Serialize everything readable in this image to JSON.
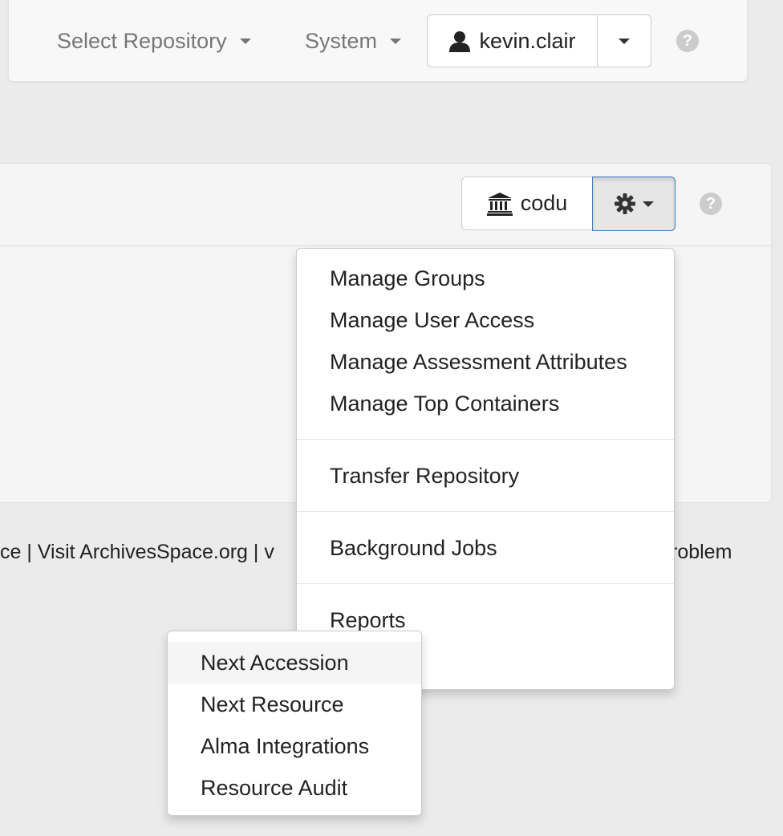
{
  "navbar": {
    "select_repository": "Select Repository",
    "system": "System",
    "username": "kevin.clair",
    "help": "?"
  },
  "repo": {
    "code": "codu",
    "help": "?"
  },
  "footer": {
    "left_text": "ce | Visit ArchivesSpace.org | v",
    "right_text": "roblem"
  },
  "gear_menu": {
    "items": [
      "Manage Groups",
      "Manage User Access",
      "Manage Assessment Attributes",
      "Manage Top Containers",
      "Transfer Repository",
      "Background Jobs",
      "Reports"
    ]
  },
  "reports_submenu": {
    "items": [
      "Next Accession",
      "Next Resource",
      "Alma Integrations",
      "Resource Audit"
    ],
    "active_index": 0
  },
  "colors": {
    "page_bg": "#ebebeb",
    "active_border": "#3b7bbf"
  }
}
